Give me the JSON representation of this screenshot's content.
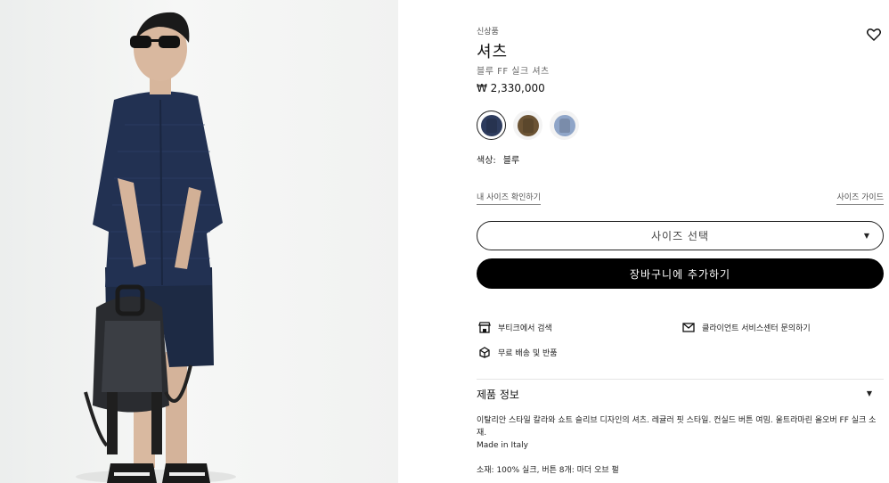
{
  "product": {
    "badge": "신상품",
    "title": "셔츠",
    "subtitle": "블루 FF 실크 셔츠",
    "price": "₩ 2,330,000",
    "colors": {
      "label": "색상:",
      "selected": "블루",
      "swatches": [
        {
          "name": "blue",
          "hex": "#2e3c5e"
        },
        {
          "name": "brown",
          "hex": "#6b5334"
        },
        {
          "name": "light-blue",
          "hex": "#8fa5c8"
        }
      ]
    }
  },
  "sizing": {
    "check_link": "내 사이즈 확인하기",
    "guide_link": "사이즈 가이드",
    "select_placeholder": "사이즈 선택"
  },
  "actions": {
    "add_to_cart": "장바구니에 추가하기"
  },
  "services": {
    "boutique": "부티크에서 검색",
    "client_service": "클라이언트 서비스센터 문의하기",
    "shipping": "무료 배송 및 반품"
  },
  "details": {
    "title": "제품 정보",
    "description": "이탈리안 스타일 칼라와 쇼트 슬리브 디자인의 셔츠. 레귤러 핏 스타일. 컨실드 버튼 여밈. 울트라마린 올오버 FF 실크 소재.",
    "made_in": "Made in Italy",
    "material": "소재: 100% 실크, 버튼 8개: 마더 오브 펄"
  }
}
